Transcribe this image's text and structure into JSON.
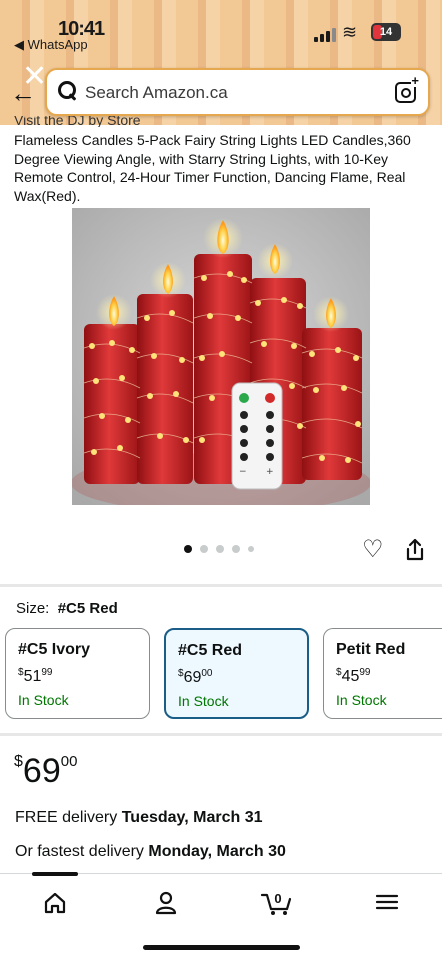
{
  "status_bar": {
    "time": "10:41",
    "back_app": "◀ WhatsApp",
    "battery": "14",
    "wifi_glyph": "≋"
  },
  "header": {
    "close_glyph": "✕",
    "back_glyph": "←",
    "search_placeholder": "Search Amazon.ca"
  },
  "product": {
    "visit_store": "Visit the DJ by Store",
    "title": "Flameless Candles 5-Pack Fairy String Lights LED Candles,360 Degree Viewing Angle, with Starry String Lights, with 10-Key Remote Control, 24-Hour Timer Function, Dancing Flame, Real Wax(Red).",
    "image_count": 5,
    "active_image": 1
  },
  "size": {
    "label": "Size:",
    "selected": "#C5 Red",
    "options": [
      {
        "name": "#C5 Ivory",
        "currency": "$",
        "whole": "51",
        "fraction": "99",
        "stock": "In Stock",
        "selected": false
      },
      {
        "name": "#C5 Red",
        "currency": "$",
        "whole": "69",
        "fraction": "00",
        "stock": "In Stock",
        "selected": true
      },
      {
        "name": "Petit Red",
        "currency": "$",
        "whole": "45",
        "fraction": "99",
        "stock": "In Stock",
        "selected": false
      }
    ]
  },
  "price": {
    "currency": "$",
    "whole": "69",
    "fraction": "00"
  },
  "delivery": {
    "free_prefix": "FREE delivery ",
    "free_date": "Tuesday, March 31",
    "fast_prefix": "Or fastest delivery ",
    "fast_date": "Monday, March 30"
  },
  "tabbar": {
    "cart_count": "0",
    "items": [
      "home-icon",
      "account-icon",
      "cart-icon",
      "menu-icon"
    ]
  },
  "colors": {
    "accent_border": "#e6a84f",
    "selected_card_border": "#1a5d86",
    "in_stock": "#007600",
    "candle_red": "#d42a2a"
  }
}
